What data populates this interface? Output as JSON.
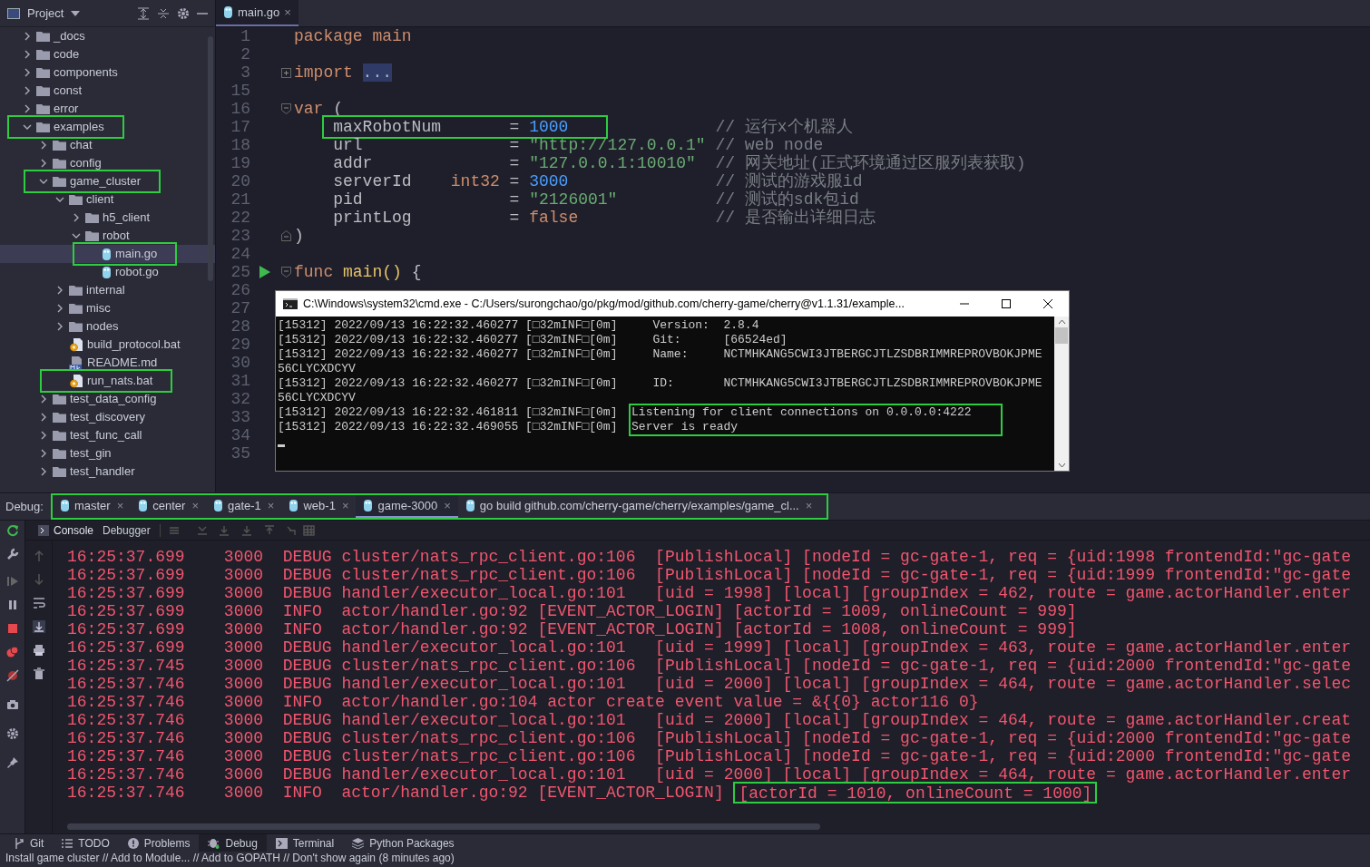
{
  "project": {
    "title": "Project",
    "tree": [
      {
        "label": "_docs",
        "kind": "folder",
        "expanded": false,
        "selected": false,
        "highlighted": false
      },
      {
        "label": "code",
        "kind": "folder",
        "expanded": false,
        "selected": false,
        "highlighted": false
      },
      {
        "label": "components",
        "kind": "folder",
        "expanded": false,
        "selected": false,
        "highlighted": false
      },
      {
        "label": "const",
        "kind": "folder",
        "expanded": false,
        "selected": false,
        "highlighted": false
      },
      {
        "label": "error",
        "kind": "folder",
        "expanded": false,
        "selected": false,
        "highlighted": false
      },
      {
        "label": "examples",
        "kind": "folder",
        "expanded": true,
        "selected": false,
        "highlighted": true,
        "children": [
          {
            "label": "chat",
            "kind": "folder",
            "expanded": false,
            "selected": false,
            "highlighted": false
          },
          {
            "label": "config",
            "kind": "folder",
            "expanded": false,
            "selected": false,
            "highlighted": false
          },
          {
            "label": "game_cluster",
            "kind": "folder",
            "expanded": true,
            "selected": false,
            "highlighted": true,
            "children": [
              {
                "label": "client",
                "kind": "folder",
                "expanded": true,
                "selected": false,
                "highlighted": false,
                "children": [
                  {
                    "label": "h5_client",
                    "kind": "folder",
                    "expanded": false,
                    "selected": false,
                    "highlighted": false
                  },
                  {
                    "label": "robot",
                    "kind": "folder",
                    "expanded": true,
                    "selected": false,
                    "highlighted": false,
                    "children": [
                      {
                        "label": "main.go",
                        "kind": "go",
                        "selected": true,
                        "highlighted": true
                      },
                      {
                        "label": "robot.go",
                        "kind": "go",
                        "selected": false,
                        "highlighted": false
                      }
                    ]
                  }
                ]
              },
              {
                "label": "internal",
                "kind": "folder",
                "expanded": false,
                "selected": false,
                "highlighted": false
              },
              {
                "label": "misc",
                "kind": "folder",
                "expanded": false,
                "selected": false,
                "highlighted": false
              },
              {
                "label": "nodes",
                "kind": "folder",
                "expanded": false,
                "selected": false,
                "highlighted": false
              },
              {
                "label": "build_protocol.bat",
                "kind": "bat",
                "selected": false,
                "highlighted": false
              },
              {
                "label": "README.md",
                "kind": "md",
                "selected": false,
                "highlighted": false
              },
              {
                "label": "run_nats.bat",
                "kind": "bat",
                "selected": false,
                "highlighted": true
              }
            ]
          },
          {
            "label": "test_data_config",
            "kind": "folder",
            "expanded": false,
            "selected": false,
            "highlighted": false
          },
          {
            "label": "test_discovery",
            "kind": "folder",
            "expanded": false,
            "selected": false,
            "highlighted": false
          },
          {
            "label": "test_func_call",
            "kind": "folder",
            "expanded": false,
            "selected": false,
            "highlighted": false
          },
          {
            "label": "test_gin",
            "kind": "folder",
            "expanded": false,
            "selected": false,
            "highlighted": false
          },
          {
            "label": "test_handler",
            "kind": "folder",
            "expanded": false,
            "selected": false,
            "highlighted": false
          }
        ]
      }
    ]
  },
  "editor": {
    "tabs": [
      {
        "label": "main.go",
        "close": "×",
        "selected": true
      }
    ],
    "lines": [
      {
        "number": "1",
        "kind": "code",
        "run": false,
        "tokens": [
          {
            "kind": "keyword",
            "text": "package"
          },
          {
            "kind": "keyword",
            "text": "main"
          }
        ]
      },
      {
        "number": "2",
        "kind": "blank",
        "run": false
      },
      {
        "number": "3",
        "kind": "code",
        "run": false,
        "fold": {
          "kind": "collapsed"
        },
        "tokens": [
          {
            "kind": "keyword",
            "text": "import"
          },
          {
            "kind": "folded",
            "text": "..."
          }
        ]
      },
      {
        "number": "15",
        "kind": "blank",
        "run": false
      },
      {
        "number": "16",
        "kind": "code",
        "run": false,
        "fold": {
          "kind": "start"
        },
        "tokens": [
          {
            "kind": "keyword",
            "text": "var"
          },
          {
            "kind": "plain",
            "text": "("
          }
        ]
      },
      {
        "number": "17",
        "kind": "var",
        "run": false,
        "highlighted": true,
        "name": "maxRobotNum",
        "operator": "=",
        "value": {
          "kind": "number",
          "text": "1000"
        },
        "comment": "// 运行x个机器人"
      },
      {
        "number": "18",
        "kind": "var",
        "run": false,
        "highlighted": false,
        "name": "url",
        "operator": "=",
        "value": {
          "kind": "string",
          "text": "\"http://127.0.0.1\""
        },
        "comment": "// web node"
      },
      {
        "number": "19",
        "kind": "var",
        "run": false,
        "highlighted": false,
        "name": "addr",
        "operator": "=",
        "value": {
          "kind": "string",
          "text": "\"127.0.0.1:10010\""
        },
        "comment": "// 网关地址(正式环境通过区服列表获取)"
      },
      {
        "number": "20",
        "kind": "var",
        "run": false,
        "highlighted": false,
        "name": "serverId",
        "type": "int32",
        "operator": "=",
        "value": {
          "kind": "number",
          "text": "3000"
        },
        "comment": "// 测试的游戏服id"
      },
      {
        "number": "21",
        "kind": "var",
        "run": false,
        "highlighted": false,
        "name": "pid",
        "operator": "=",
        "value": {
          "kind": "string",
          "text": "\"2126001\""
        },
        "comment": "// 测试的sdk包id"
      },
      {
        "number": "22",
        "kind": "var",
        "run": false,
        "highlighted": false,
        "name": "printLog",
        "operator": "=",
        "value": {
          "kind": "keyword",
          "text": "false"
        },
        "comment": "// 是否输出详细日志"
      },
      {
        "number": "23",
        "kind": "code",
        "run": false,
        "fold": {
          "kind": "end"
        },
        "tokens": [
          {
            "kind": "plain",
            "text": ")"
          }
        ]
      },
      {
        "number": "24",
        "kind": "blank",
        "run": false
      },
      {
        "number": "25",
        "kind": "code",
        "run": true,
        "fold": {
          "kind": "start"
        },
        "tokens": [
          {
            "kind": "keyword",
            "text": "func"
          },
          {
            "kind": "function",
            "text": "main()"
          },
          {
            "kind": "plain",
            "text": "{"
          }
        ]
      },
      {
        "number": "26",
        "kind": "blank",
        "run": false
      },
      {
        "number": "27",
        "kind": "blank",
        "run": false
      },
      {
        "number": "28",
        "kind": "blank",
        "run": false
      },
      {
        "number": "29",
        "kind": "blank",
        "run": false
      },
      {
        "number": "30",
        "kind": "blank",
        "run": false
      },
      {
        "number": "31",
        "kind": "blank",
        "run": false
      },
      {
        "number": "32",
        "kind": "blank",
        "run": false
      },
      {
        "number": "33",
        "kind": "blank",
        "run": false
      },
      {
        "number": "34",
        "kind": "blank",
        "run": false
      },
      {
        "number": "35",
        "kind": "blank",
        "run": false
      }
    ]
  },
  "cmd_window": {
    "title": "C:\\Windows\\system32\\cmd.exe - C:/Users/surongchao/go/pkg/mod/github.com/cherry-game/cherry@v1.1.31/example...",
    "lines": [
      {
        "kind": "field",
        "prefix": "[15312] 2022/09/13 16:22:32.460277 [□32mINF□[0m]",
        "label": "Version:",
        "value": "2.8.4"
      },
      {
        "kind": "field",
        "prefix": "[15312] 2022/09/13 16:22:32.460277 [□32mINF□[0m]",
        "label": "Git:",
        "value": "[66524ed]"
      },
      {
        "kind": "field",
        "prefix": "[15312] 2022/09/13 16:22:32.460277 [□32mINF□[0m]",
        "label": "Name:",
        "value": "NCTMHKANG5CWI3JTBERGCJTLZSDBRIMMREPROVBOKJPME"
      },
      {
        "kind": "wrap",
        "text": "56CLYCXDCYV"
      },
      {
        "kind": "field",
        "prefix": "[15312] 2022/09/13 16:22:32.460277 [□32mINF□[0m]",
        "label": "ID:",
        "value": "NCTMHKANG5CWI3JTBERGCJTLZSDBRIMMREPROVBOKJPME"
      },
      {
        "kind": "wrap",
        "text": "56CLYCXDCYV"
      },
      {
        "kind": "message",
        "prefix": "[15312] 2022/09/13 16:22:32.461811 [□32mINF□[0m]",
        "message": "Listening for client connections on 0.0.0.0:4222",
        "highlighted": true
      },
      {
        "kind": "message",
        "prefix": "[15312] 2022/09/13 16:22:32.469055 [□32mINF□[0m]",
        "message": "Server is ready",
        "highlighted": true
      }
    ]
  },
  "debug": {
    "label": "Debug:",
    "tabs_highlighted": true,
    "tabs": [
      {
        "label": "master",
        "selected": false
      },
      {
        "label": "center",
        "selected": false
      },
      {
        "label": "gate-1",
        "selected": false
      },
      {
        "label": "web-1",
        "selected": false
      },
      {
        "label": "game-3000",
        "selected": true
      },
      {
        "label": "go build github.com/cherry-game/cherry/examples/game_cl...",
        "selected": false
      }
    ],
    "tab_close": "×",
    "subtabs": [
      {
        "label": "Console",
        "selected": true
      },
      {
        "label": "Debugger",
        "selected": false
      }
    ],
    "console": [
      {
        "time": "16:25:37.699",
        "node": "3000",
        "level": "DEBUG",
        "source": "cluster/nats_rpc_client.go:106",
        "message": "[PublishLocal] [nodeId = gc-gate-1, req = {uid:1998 frontendId:\"gc-gate",
        "highlighted": false
      },
      {
        "time": "16:25:37.699",
        "node": "3000",
        "level": "DEBUG",
        "source": "cluster/nats_rpc_client.go:106",
        "message": "[PublishLocal] [nodeId = gc-gate-1, req = {uid:1999 frontendId:\"gc-gate",
        "highlighted": false
      },
      {
        "time": "16:25:37.699",
        "node": "3000",
        "level": "DEBUG",
        "source": "handler/executor_local.go:101",
        "message": "[uid = 1998] [local] [groupIndex = 462, route = game.actorHandler.enter",
        "highlighted": false
      },
      {
        "time": "16:25:37.699",
        "node": "3000",
        "level": "INFO",
        "source": "actor/handler.go:92",
        "message": "[EVENT_ACTOR_LOGIN] [actorId = 1009, onlineCount = 999]",
        "highlighted": false
      },
      {
        "time": "16:25:37.699",
        "node": "3000",
        "level": "INFO",
        "source": "actor/handler.go:92",
        "message": "[EVENT_ACTOR_LOGIN] [actorId = 1008, onlineCount = 999]",
        "highlighted": false
      },
      {
        "time": "16:25:37.699",
        "node": "3000",
        "level": "DEBUG",
        "source": "handler/executor_local.go:101",
        "message": "[uid = 1999] [local] [groupIndex = 463, route = game.actorHandler.enter",
        "highlighted": false
      },
      {
        "time": "16:25:37.745",
        "node": "3000",
        "level": "DEBUG",
        "source": "cluster/nats_rpc_client.go:106",
        "message": "[PublishLocal] [nodeId = gc-gate-1, req = {uid:2000 frontendId:\"gc-gate",
        "highlighted": false
      },
      {
        "time": "16:25:37.746",
        "node": "3000",
        "level": "DEBUG",
        "source": "handler/executor_local.go:101",
        "message": "[uid = 2000] [local] [groupIndex = 464, route = game.actorHandler.selec",
        "highlighted": false
      },
      {
        "time": "16:25:37.746",
        "node": "3000",
        "level": "INFO",
        "source": "actor/handler.go:104",
        "message": "actor create event value = &{{0} actor116 0}",
        "highlighted": false
      },
      {
        "time": "16:25:37.746",
        "node": "3000",
        "level": "DEBUG",
        "source": "handler/executor_local.go:101",
        "message": "[uid = 2000] [local] [groupIndex = 464, route = game.actorHandler.creat",
        "highlighted": false
      },
      {
        "time": "16:25:37.746",
        "node": "3000",
        "level": "DEBUG",
        "source": "cluster/nats_rpc_client.go:106",
        "message": "[PublishLocal] [nodeId = gc-gate-1, req = {uid:2000 frontendId:\"gc-gate",
        "highlighted": false
      },
      {
        "time": "16:25:37.746",
        "node": "3000",
        "level": "DEBUG",
        "source": "cluster/nats_rpc_client.go:106",
        "message": "[PublishLocal] [nodeId = gc-gate-1, req = {uid:2000 frontendId:\"gc-gate",
        "highlighted": false
      },
      {
        "time": "16:25:37.746",
        "node": "3000",
        "level": "DEBUG",
        "source": "handler/executor_local.go:101",
        "message": "[uid = 2000] [local] [groupIndex = 464, route = game.actorHandler.enter",
        "highlighted": false
      },
      {
        "time": "16:25:37.746",
        "node": "3000",
        "level": "INFO",
        "source": "actor/handler.go:92",
        "message": "[EVENT_ACTOR_LOGIN]",
        "highlight": "[actorId = 1010, onlineCount = 1000]",
        "highlighted": true
      }
    ]
  },
  "tool_windows": [
    {
      "label": "Git",
      "selected": false
    },
    {
      "label": "TODO",
      "selected": false
    },
    {
      "label": "Problems",
      "selected": false
    },
    {
      "label": "Debug",
      "selected": true
    },
    {
      "label": "Terminal",
      "selected": false
    },
    {
      "label": "Python Packages",
      "selected": false
    }
  ],
  "status_bar": "Install game cluster // Add to Module... // Add to GOPATH // Don't show again (8 minutes ago)"
}
